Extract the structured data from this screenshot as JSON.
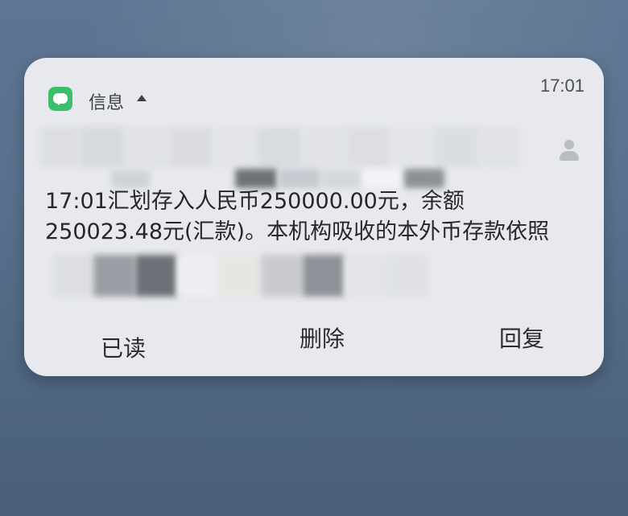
{
  "notification": {
    "app_name": "信息",
    "time": "17:01",
    "message": {
      "line1": "17:01汇划存入人民币250000.00元，余额",
      "line2": "250023.48元(汇款)。本机构吸收的本外币存款依照"
    },
    "actions": {
      "read": "已读",
      "delete": "删除",
      "reply": "回复"
    }
  },
  "icons": {
    "app": "messages-icon",
    "expand": "caret-up-icon",
    "avatar": "contact-avatar-icon"
  },
  "colors": {
    "app_icon": "#3bbf6a",
    "card_background": "#e7e9ee",
    "screen_background": "#5a7290",
    "text": "#25272c"
  }
}
